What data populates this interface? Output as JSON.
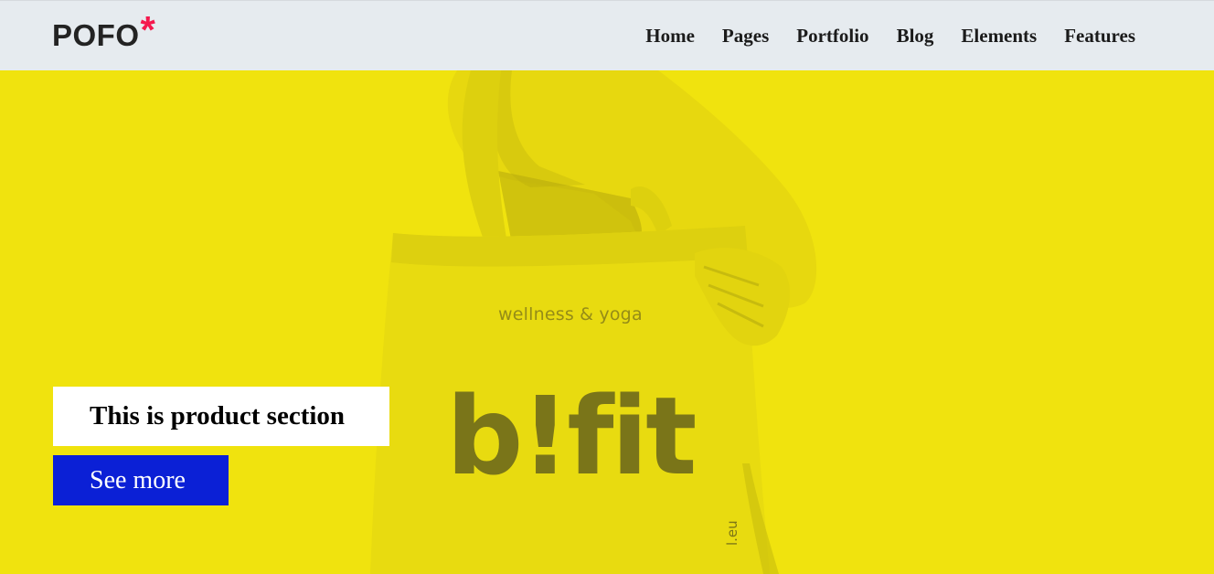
{
  "header": {
    "logo": {
      "text": "POFO",
      "mark": "*",
      "mark_color": "#f5184d"
    },
    "nav": [
      {
        "label": "Home"
      },
      {
        "label": "Pages"
      },
      {
        "label": "Portfolio"
      },
      {
        "label": "Blog"
      },
      {
        "label": "Elements"
      },
      {
        "label": "Features"
      }
    ]
  },
  "hero": {
    "background_color": "#f0e30e",
    "image": {
      "subject": "person carrying a tote bag",
      "bag_tagline": "wellness & yoga",
      "bag_brand": "b!fit",
      "bag_side_text": "l.eu"
    },
    "product_title": "This is product section",
    "cta_label": "See more",
    "cta_color": "#0b20d6"
  }
}
